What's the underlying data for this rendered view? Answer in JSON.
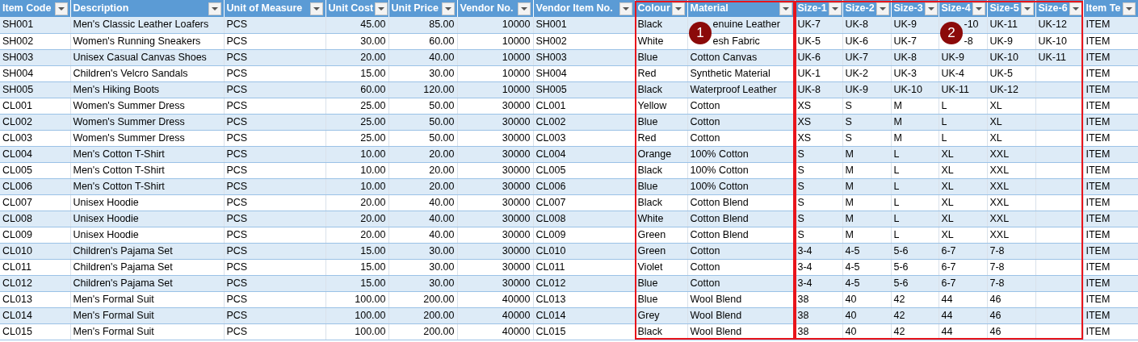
{
  "column_groups": [
    {
      "framed": false,
      "columns": [
        {
          "label": "Item Code",
          "numeric": false
        },
        {
          "label": "Description",
          "numeric": false
        },
        {
          "label": "Unit of Measure",
          "numeric": false
        },
        {
          "label": "Unit Cost",
          "numeric": true
        },
        {
          "label": "Unit Price",
          "numeric": true
        },
        {
          "label": "Vendor No.",
          "numeric": true
        },
        {
          "label": "Vendor Item No.",
          "numeric": false
        }
      ]
    },
    {
      "framed": true,
      "columns": [
        {
          "label": "Colour",
          "numeric": false
        },
        {
          "label": "Material",
          "numeric": false,
          "callout": "1"
        }
      ]
    },
    {
      "framed": true,
      "columns": [
        {
          "label": "Size-1",
          "numeric": false
        },
        {
          "label": "Size-2",
          "numeric": false
        },
        {
          "label": "Size-3",
          "numeric": false
        },
        {
          "label": "Size-4",
          "numeric": false,
          "callout": "2"
        },
        {
          "label": "Size-5",
          "numeric": false
        },
        {
          "label": "Size-6",
          "numeric": false
        }
      ]
    },
    {
      "framed": false,
      "columns": [
        {
          "label": "Item Te",
          "numeric": false
        }
      ]
    }
  ],
  "rows": [
    {
      "item_code": "SH001",
      "description": "Men's Classic Leather Loafers",
      "unit": "PCS",
      "cost": "45.00",
      "price": "85.00",
      "vendor": "10000",
      "vendor_item": "SH001",
      "colour": "Black",
      "material": "enuine Leather",
      "sizes": [
        "UK-7",
        "UK-8",
        "UK-9",
        "-10",
        "UK-11",
        "UK-12"
      ],
      "item_type": "ITEM"
    },
    {
      "item_code": "SH002",
      "description": "Women's Running Sneakers",
      "unit": "PCS",
      "cost": "30.00",
      "price": "60.00",
      "vendor": "10000",
      "vendor_item": "SH002",
      "colour": "White",
      "material": "esh Fabric",
      "sizes": [
        "UK-5",
        "UK-6",
        "UK-7",
        "-8",
        "UK-9",
        "UK-10"
      ],
      "item_type": "ITEM"
    },
    {
      "item_code": "SH003",
      "description": "Unisex Casual Canvas Shoes",
      "unit": "PCS",
      "cost": "20.00",
      "price": "40.00",
      "vendor": "10000",
      "vendor_item": "SH003",
      "colour": "Blue",
      "material": "Cotton Canvas",
      "sizes": [
        "UK-6",
        "UK-7",
        "UK-8",
        "UK-9",
        "UK-10",
        "UK-11"
      ],
      "item_type": "ITEM"
    },
    {
      "item_code": "SH004",
      "description": "Children's Velcro Sandals",
      "unit": "PCS",
      "cost": "15.00",
      "price": "30.00",
      "vendor": "10000",
      "vendor_item": "SH004",
      "colour": "Red",
      "material": "Synthetic Material",
      "sizes": [
        "UK-1",
        "UK-2",
        "UK-3",
        "UK-4",
        "UK-5"
      ],
      "item_type": "ITEM"
    },
    {
      "item_code": "SH005",
      "description": "Men's Hiking Boots",
      "unit": "PCS",
      "cost": "60.00",
      "price": "120.00",
      "vendor": "10000",
      "vendor_item": "SH005",
      "colour": "Black",
      "material": "Waterproof Leather",
      "sizes": [
        "UK-8",
        "UK-9",
        "UK-10",
        "UK-11",
        "UK-12"
      ],
      "item_type": "ITEM"
    },
    {
      "item_code": "CL001",
      "description": "Women's Summer Dress",
      "unit": "PCS",
      "cost": "25.00",
      "price": "50.00",
      "vendor": "30000",
      "vendor_item": "CL001",
      "colour": "Yellow",
      "material": "Cotton",
      "sizes": [
        "XS",
        "S",
        "M",
        "L",
        "XL"
      ],
      "item_type": "ITEM"
    },
    {
      "item_code": "CL002",
      "description": "Women's Summer Dress",
      "unit": "PCS",
      "cost": "25.00",
      "price": "50.00",
      "vendor": "30000",
      "vendor_item": "CL002",
      "colour": "Blue",
      "material": "Cotton",
      "sizes": [
        "XS",
        "S",
        "M",
        "L",
        "XL"
      ],
      "item_type": "ITEM"
    },
    {
      "item_code": "CL003",
      "description": "Women's Summer Dress",
      "unit": "PCS",
      "cost": "25.00",
      "price": "50.00",
      "vendor": "30000",
      "vendor_item": "CL003",
      "colour": "Red",
      "material": "Cotton",
      "sizes": [
        "XS",
        "S",
        "M",
        "L",
        "XL"
      ],
      "item_type": "ITEM"
    },
    {
      "item_code": "CL004",
      "description": "Men's Cotton T-Shirt",
      "unit": "PCS",
      "cost": "10.00",
      "price": "20.00",
      "vendor": "30000",
      "vendor_item": "CL004",
      "colour": "Orange",
      "material": "100% Cotton",
      "sizes": [
        "S",
        "M",
        "L",
        "XL",
        "XXL"
      ],
      "item_type": "ITEM"
    },
    {
      "item_code": "CL005",
      "description": "Men's Cotton T-Shirt",
      "unit": "PCS",
      "cost": "10.00",
      "price": "20.00",
      "vendor": "30000",
      "vendor_item": "CL005",
      "colour": "Black",
      "material": "100% Cotton",
      "sizes": [
        "S",
        "M",
        "L",
        "XL",
        "XXL"
      ],
      "item_type": "ITEM"
    },
    {
      "item_code": "CL006",
      "description": "Men's Cotton T-Shirt",
      "unit": "PCS",
      "cost": "10.00",
      "price": "20.00",
      "vendor": "30000",
      "vendor_item": "CL006",
      "colour": "Blue",
      "material": "100% Cotton",
      "sizes": [
        "S",
        "M",
        "L",
        "XL",
        "XXL"
      ],
      "item_type": "ITEM"
    },
    {
      "item_code": "CL007",
      "description": "Unisex Hoodie",
      "unit": "PCS",
      "cost": "20.00",
      "price": "40.00",
      "vendor": "30000",
      "vendor_item": "CL007",
      "colour": "Black",
      "material": "Cotton Blend",
      "sizes": [
        "S",
        "M",
        "L",
        "XL",
        "XXL"
      ],
      "item_type": "ITEM"
    },
    {
      "item_code": "CL008",
      "description": "Unisex Hoodie",
      "unit": "PCS",
      "cost": "20.00",
      "price": "40.00",
      "vendor": "30000",
      "vendor_item": "CL008",
      "colour": "White",
      "material": "Cotton Blend",
      "sizes": [
        "S",
        "M",
        "L",
        "XL",
        "XXL"
      ],
      "item_type": "ITEM"
    },
    {
      "item_code": "CL009",
      "description": "Unisex Hoodie",
      "unit": "PCS",
      "cost": "20.00",
      "price": "40.00",
      "vendor": "30000",
      "vendor_item": "CL009",
      "colour": "Green",
      "material": "Cotton Blend",
      "sizes": [
        "S",
        "M",
        "L",
        "XL",
        "XXL"
      ],
      "item_type": "ITEM"
    },
    {
      "item_code": "CL010",
      "description": "Children's Pajama Set",
      "unit": "PCS",
      "cost": "15.00",
      "price": "30.00",
      "vendor": "30000",
      "vendor_item": "CL010",
      "colour": "Green",
      "material": "Cotton",
      "sizes": [
        "3-4",
        "4-5",
        "5-6",
        "6-7",
        "7-8"
      ],
      "item_type": "ITEM"
    },
    {
      "item_code": "CL011",
      "description": "Children's Pajama Set",
      "unit": "PCS",
      "cost": "15.00",
      "price": "30.00",
      "vendor": "30000",
      "vendor_item": "CL011",
      "colour": "Violet",
      "material": "Cotton",
      "sizes": [
        "3-4",
        "4-5",
        "5-6",
        "6-7",
        "7-8"
      ],
      "item_type": "ITEM"
    },
    {
      "item_code": "CL012",
      "description": "Children's Pajama Set",
      "unit": "PCS",
      "cost": "15.00",
      "price": "30.00",
      "vendor": "30000",
      "vendor_item": "CL012",
      "colour": "Blue",
      "material": "Cotton",
      "sizes": [
        "3-4",
        "4-5",
        "5-6",
        "6-7",
        "7-8"
      ],
      "item_type": "ITEM"
    },
    {
      "item_code": "CL013",
      "description": "Men's Formal Suit",
      "unit": "PCS",
      "cost": "100.00",
      "price": "200.00",
      "vendor": "40000",
      "vendor_item": "CL013",
      "colour": "Blue",
      "material": "Wool Blend",
      "sizes": [
        "38",
        "40",
        "42",
        "44",
        "46"
      ],
      "item_type": "ITEM"
    },
    {
      "item_code": "CL014",
      "description": "Men's Formal Suit",
      "unit": "PCS",
      "cost": "100.00",
      "price": "200.00",
      "vendor": "40000",
      "vendor_item": "CL014",
      "colour": "Grey",
      "material": "Wool Blend",
      "sizes": [
        "38",
        "40",
        "42",
        "44",
        "46"
      ],
      "item_type": "ITEM"
    },
    {
      "item_code": "CL015",
      "description": "Men's Formal Suit",
      "unit": "PCS",
      "cost": "100.00",
      "price": "200.00",
      "vendor": "40000",
      "vendor_item": "CL015",
      "colour": "Black",
      "material": "Wool Blend",
      "sizes": [
        "38",
        "40",
        "42",
        "44",
        "46"
      ],
      "item_type": "ITEM"
    }
  ]
}
